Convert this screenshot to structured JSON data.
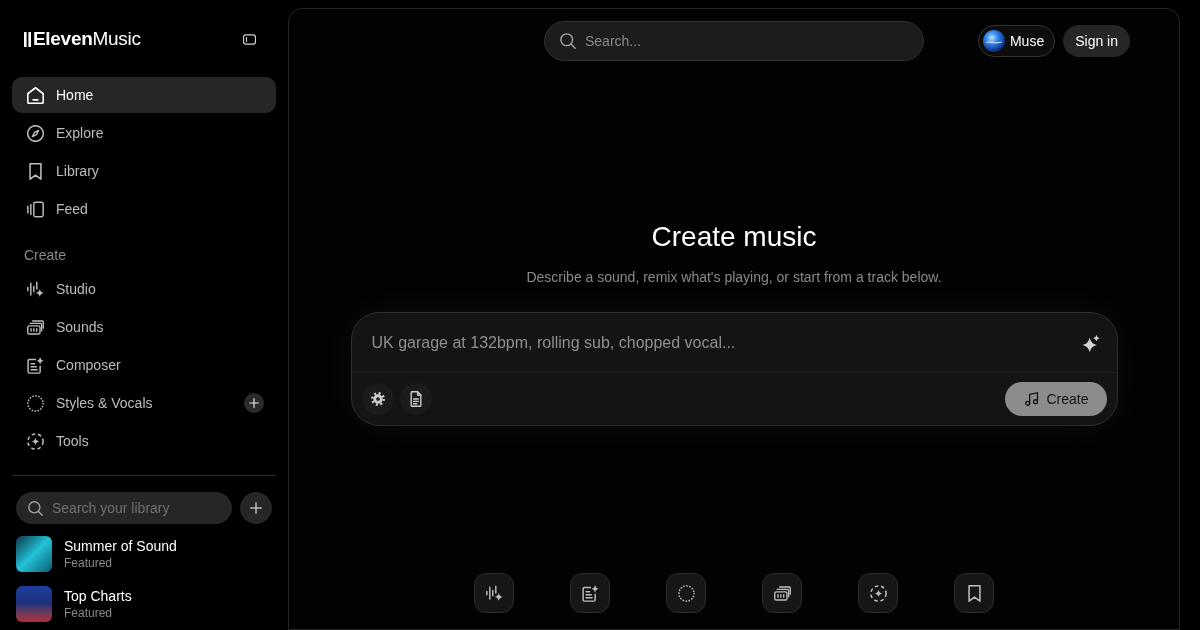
{
  "sidebar": {
    "logo": "**Eleven**Music",
    "nav": [
      {
        "label": "Home",
        "selected": true
      },
      {
        "label": "Explore",
        "selected": false
      },
      {
        "label": "Library",
        "selected": false
      },
      {
        "label": "Feed",
        "selected": false
      }
    ],
    "create": {
      "title": "Create",
      "items": [
        {
          "label": "Studio",
          "selected": false,
          "add_button": false
        },
        {
          "label": "Sounds",
          "selected": false,
          "add_button": false
        },
        {
          "label": "Composer",
          "selected": false,
          "add_button": false
        },
        {
          "label": "Styles & Vocals",
          "selected": false,
          "add_button": true
        },
        {
          "label": "Tools",
          "selected": false,
          "add_button": false
        }
      ]
    },
    "library": {
      "search": {
        "placeholder": "Search your library"
      },
      "items": [
        {
          "title": "Summer of Sound",
          "subtitle": "Featured"
        },
        {
          "title": "Top Charts",
          "subtitle": "Featured"
        }
      ]
    }
  },
  "top_bar": {
    "search": {
      "placeholder": "Search..."
    },
    "buttons": [
      {
        "label": "Muse",
        "kind": "avatar"
      },
      {
        "label": "Sign in",
        "kind": "plain"
      }
    ]
  },
  "hero": {
    "title": "Create music",
    "subtitle": "Describe a sound, remix what's playing, or start from a track below."
  },
  "prompt": {
    "placeholder": "UK garage at 132bpm, rolling sub, chopped vocal...",
    "submit": "Create"
  }
}
